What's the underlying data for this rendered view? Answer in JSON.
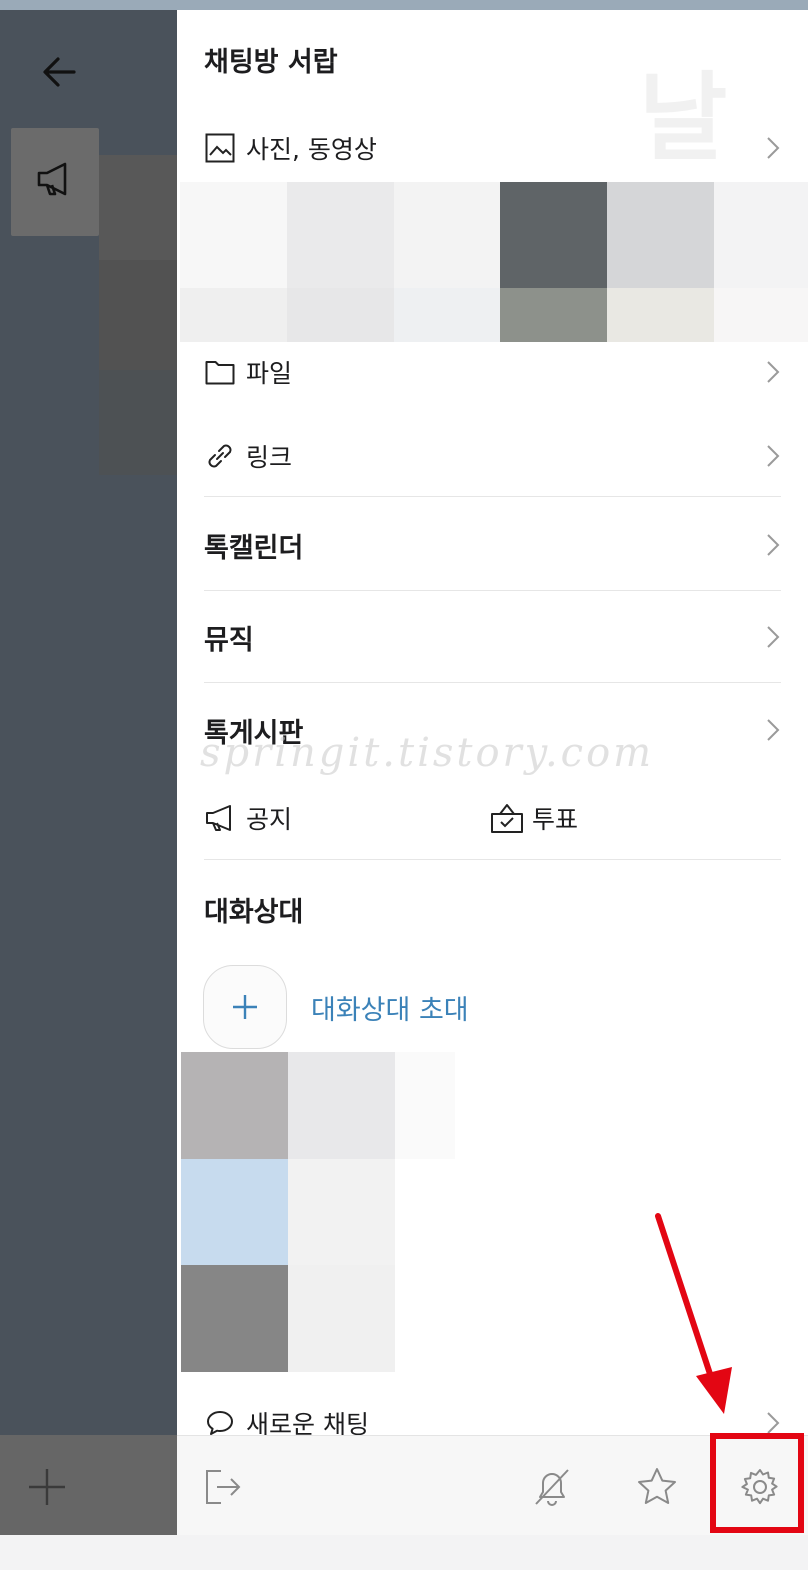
{
  "drawer": {
    "title": "채팅방 서랍",
    "watermark_big": "날",
    "items": {
      "photos": "사진, 동영상",
      "files": "파일",
      "links": "링크",
      "talk_calendar": "톡캘린더",
      "music": "뮤직",
      "talk_board": "톡게시판",
      "notice": "공지",
      "vote": "투표"
    },
    "members_section": {
      "title": "대화상대",
      "invite_label": "대화상대 초대"
    },
    "new_chat_label": "새로운 채팅"
  },
  "watermark_text": "springit.tistory.com",
  "colors": {
    "accent_blue": "#3b82b8",
    "highlight_red": "#e30613",
    "overlay": "#4a525b"
  },
  "bottom_bar": {
    "icons": [
      "exit-icon",
      "bell-off-icon",
      "star-icon",
      "settings-gear-icon"
    ]
  }
}
